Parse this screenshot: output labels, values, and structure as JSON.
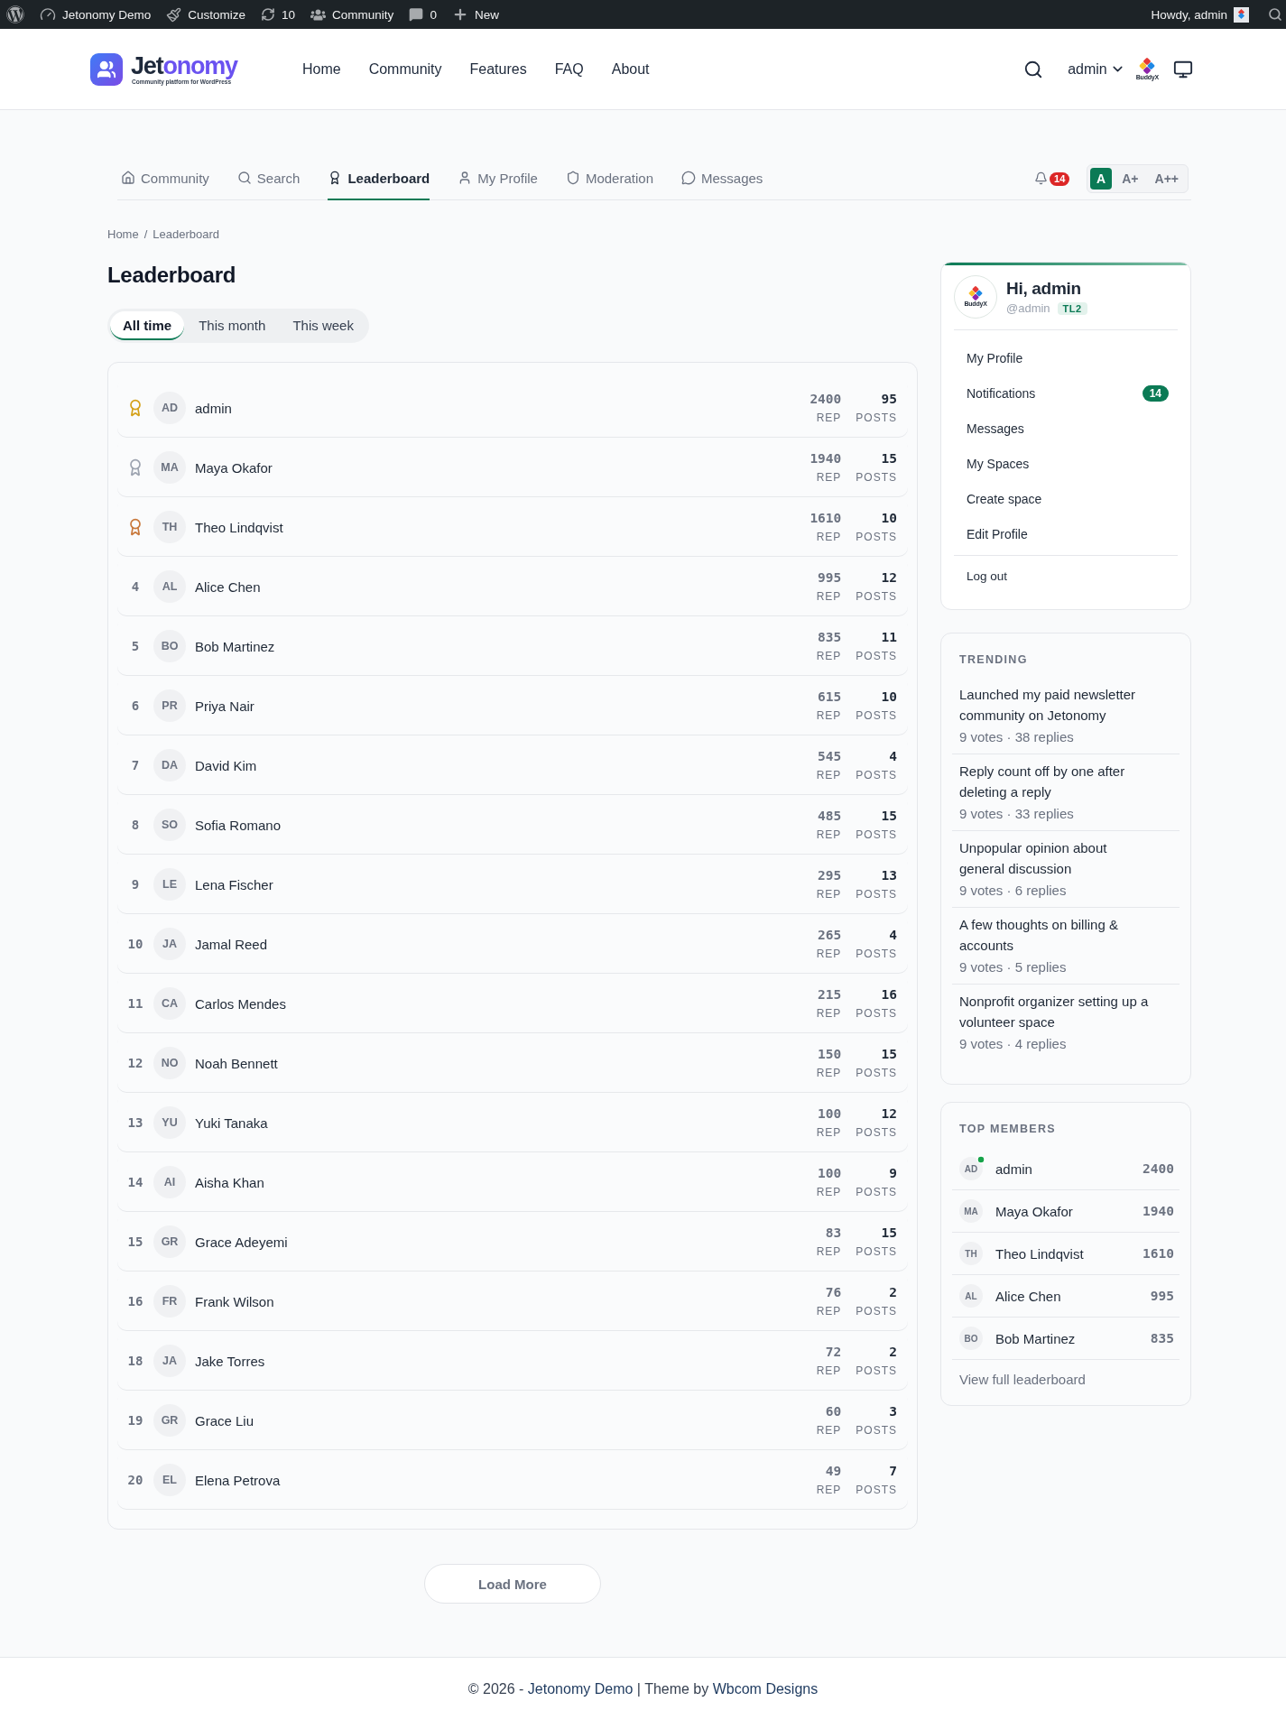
{
  "admin_bar": {
    "site": "Jetonomy Demo",
    "customize": "Customize",
    "updates": "10",
    "community": "Community",
    "comments": "0",
    "new": "New",
    "greeting": "Howdy, admin"
  },
  "header": {
    "logo": {
      "name": "Jet",
      "name_accent": "onomy",
      "tagline": "Community platform for WordPress"
    },
    "nav": [
      "Home",
      "Community",
      "Features",
      "FAQ",
      "About"
    ],
    "user": "admin",
    "avatar_text": "BuddyX"
  },
  "tabs": [
    {
      "label": "Community",
      "selected": false
    },
    {
      "label": "Search",
      "selected": false
    },
    {
      "label": "Leaderboard",
      "selected": true
    },
    {
      "label": "My Profile",
      "selected": false
    },
    {
      "label": "Moderation",
      "selected": false
    },
    {
      "label": "Messages",
      "selected": false
    }
  ],
  "notifications": {
    "count": "14"
  },
  "font_sizes": [
    {
      "label": "A",
      "selected": true
    },
    {
      "label": "A+",
      "selected": false
    },
    {
      "label": "A++",
      "selected": false
    }
  ],
  "breadcrumb": {
    "items": [
      "Home",
      "Leaderboard"
    ],
    "separator": "/"
  },
  "page_title": "Leaderboard",
  "periods": [
    {
      "label": "All time",
      "selected": true
    },
    {
      "label": "This month",
      "selected": false
    },
    {
      "label": "This week",
      "selected": false
    }
  ],
  "leaderboard": {
    "rows": [
      {
        "kind": "medal",
        "color": "#d4a017",
        "initials": "AD",
        "name": "admin",
        "rep": "2400",
        "rep_label": "REP",
        "posts": "95",
        "posts_label": "POSTS"
      },
      {
        "kind": "medal",
        "color": "#9ca3af",
        "initials": "MA",
        "name": "Maya Okafor",
        "rep": "1940",
        "rep_label": "REP",
        "posts": "15",
        "posts_label": "POSTS"
      },
      {
        "kind": "medal",
        "color": "#c8773a",
        "initials": "TH",
        "name": "Theo Lindqvist",
        "rep": "1610",
        "rep_label": "REP",
        "posts": "10",
        "posts_label": "POSTS"
      },
      {
        "kind": "rank",
        "rank": "4",
        "initials": "AL",
        "name": "Alice Chen",
        "rep": "995",
        "rep_label": "REP",
        "posts": "12",
        "posts_label": "POSTS"
      },
      {
        "kind": "rank",
        "rank": "5",
        "initials": "BO",
        "name": "Bob Martinez",
        "rep": "835",
        "rep_label": "REP",
        "posts": "11",
        "posts_label": "POSTS"
      },
      {
        "kind": "rank",
        "rank": "6",
        "initials": "PR",
        "name": "Priya Nair",
        "rep": "615",
        "rep_label": "REP",
        "posts": "10",
        "posts_label": "POSTS"
      },
      {
        "kind": "rank",
        "rank": "7",
        "initials": "DA",
        "name": "David Kim",
        "rep": "545",
        "rep_label": "REP",
        "posts": "4",
        "posts_label": "POSTS"
      },
      {
        "kind": "rank",
        "rank": "8",
        "initials": "SO",
        "name": "Sofia Romano",
        "rep": "485",
        "rep_label": "REP",
        "posts": "15",
        "posts_label": "POSTS"
      },
      {
        "kind": "rank",
        "rank": "9",
        "initials": "LE",
        "name": "Lena Fischer",
        "rep": "295",
        "rep_label": "REP",
        "posts": "13",
        "posts_label": "POSTS"
      },
      {
        "kind": "rank",
        "rank": "10",
        "initials": "JA",
        "name": "Jamal Reed",
        "rep": "265",
        "rep_label": "REP",
        "posts": "4",
        "posts_label": "POSTS"
      },
      {
        "kind": "rank",
        "rank": "11",
        "initials": "CA",
        "name": "Carlos Mendes",
        "rep": "215",
        "rep_label": "REP",
        "posts": "16",
        "posts_label": "POSTS"
      },
      {
        "kind": "rank",
        "rank": "12",
        "initials": "NO",
        "name": "Noah Bennett",
        "rep": "150",
        "rep_label": "REP",
        "posts": "15",
        "posts_label": "POSTS"
      },
      {
        "kind": "rank",
        "rank": "13",
        "initials": "YU",
        "name": "Yuki Tanaka",
        "rep": "100",
        "rep_label": "REP",
        "posts": "12",
        "posts_label": "POSTS"
      },
      {
        "kind": "rank",
        "rank": "14",
        "initials": "AI",
        "name": "Aisha Khan",
        "rep": "100",
        "rep_label": "REP",
        "posts": "9",
        "posts_label": "POSTS"
      },
      {
        "kind": "rank",
        "rank": "15",
        "initials": "GR",
        "name": "Grace Adeyemi",
        "rep": "83",
        "rep_label": "REP",
        "posts": "15",
        "posts_label": "POSTS"
      },
      {
        "kind": "rank",
        "rank": "16",
        "initials": "FR",
        "name": "Frank Wilson",
        "rep": "76",
        "rep_label": "REP",
        "posts": "2",
        "posts_label": "POSTS"
      },
      {
        "kind": "rank",
        "rank": "18",
        "initials": "JA",
        "name": "Jake Torres",
        "rep": "72",
        "rep_label": "REP",
        "posts": "2",
        "posts_label": "POSTS"
      },
      {
        "kind": "rank",
        "rank": "19",
        "initials": "GR",
        "name": "Grace Liu",
        "rep": "60",
        "rep_label": "REP",
        "posts": "3",
        "posts_label": "POSTS"
      },
      {
        "kind": "rank",
        "rank": "20",
        "initials": "EL",
        "name": "Elena Petrova",
        "rep": "49",
        "rep_label": "REP",
        "posts": "7",
        "posts_label": "POSTS"
      }
    ]
  },
  "load_more": "Load More",
  "sidebar": {
    "profile": {
      "avatar_text": "BuddyX",
      "greeting": "Hi, admin",
      "handle": "@admin",
      "trust_badge": "TL2",
      "menu": [
        {
          "label": "My Profile"
        },
        {
          "label": "Notifications",
          "badge": "14"
        },
        {
          "label": "Messages"
        },
        {
          "label": "My Spaces"
        },
        {
          "label": "Create space"
        },
        {
          "label": "Edit Profile"
        }
      ],
      "logout": "Log out"
    },
    "trending": {
      "title": "TRENDING",
      "items": [
        {
          "title": "Launched my paid newsletter community on Jetonomy",
          "meta": "9 votes · 38 replies"
        },
        {
          "title": "Reply count off by one after deleting a reply",
          "meta": "9 votes · 33 replies"
        },
        {
          "title": "Unpopular opinion about general discussion",
          "meta": "9 votes · 6 replies"
        },
        {
          "title": "A few thoughts on billing & accounts",
          "meta": "9 votes · 5 replies"
        },
        {
          "title": "Nonprofit organizer setting up a volunteer space",
          "meta": "9 votes · 4 replies"
        }
      ]
    },
    "top_members": {
      "title": "TOP MEMBERS",
      "members": [
        {
          "initials": "AD",
          "name": "admin",
          "score": "2400",
          "online": true
        },
        {
          "initials": "MA",
          "name": "Maya Okafor",
          "score": "1940",
          "online": false
        },
        {
          "initials": "TH",
          "name": "Theo Lindqvist",
          "score": "1610",
          "online": false
        },
        {
          "initials": "AL",
          "name": "Alice Chen",
          "score": "995",
          "online": false
        },
        {
          "initials": "BO",
          "name": "Bob Martinez",
          "score": "835",
          "online": false
        }
      ],
      "link": "View full leaderboard"
    }
  },
  "footer": {
    "copyright": "© 2026 -",
    "site_link": "Jetonomy Demo",
    "separator": "| Theme by",
    "theme_link": "Wbcom Designs"
  }
}
